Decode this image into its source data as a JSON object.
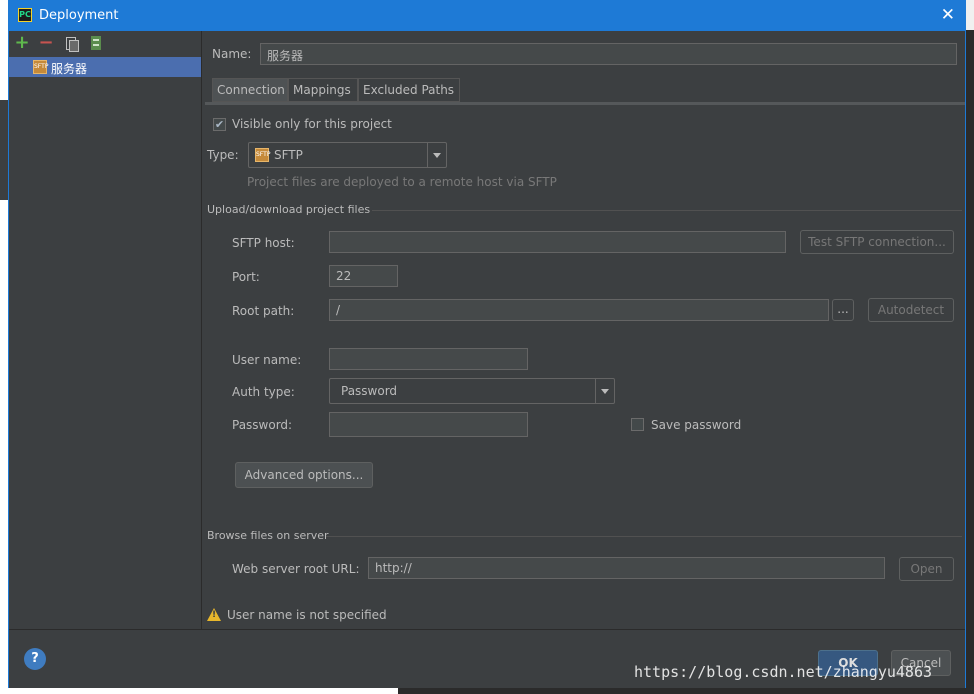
{
  "window": {
    "title": "Deployment",
    "app_icon": "PC"
  },
  "sidebar": {
    "toolbar": {
      "add": "+",
      "remove": "−"
    },
    "items": [
      {
        "label": "服务器",
        "icon": "sftp-icon"
      }
    ]
  },
  "form": {
    "name_label": "Name:",
    "name_value": "服务器",
    "tabs": [
      "Connection",
      "Mappings",
      "Excluded Paths"
    ],
    "visible_only_label": "Visible only for this project",
    "visible_only_checked": true,
    "type_label": "Type:",
    "type_value": "SFTP",
    "type_hint": "Project files are deployed to a remote host via SFTP",
    "upload_section": "Upload/download project files",
    "sftp_host_label": "SFTP host:",
    "sftp_host_value": "",
    "test_button": "Test SFTP connection...",
    "port_label": "Port:",
    "port_value": "22",
    "root_path_label": "Root path:",
    "root_path_value": "/",
    "browse_button": "...",
    "autodetect_button": "Autodetect",
    "user_name_label": "User name:",
    "user_name_value": "",
    "auth_type_label": "Auth type:",
    "auth_type_value": "Password",
    "password_label": "Password:",
    "password_value": "",
    "save_password_label": "Save password",
    "save_password_checked": false,
    "advanced_button": "Advanced options...",
    "browse_section": "Browse files on server",
    "web_root_label": "Web server root URL:",
    "web_root_value": "http://",
    "open_button": "Open",
    "warning_text": "User name is not specified"
  },
  "footer": {
    "help": "?",
    "ok": "OK",
    "cancel": "Cancel"
  },
  "watermark": "https://blog.csdn.net/zhangyu4863",
  "colors": {
    "titlebar": "#1e7ad6",
    "panel": "#3c3f41",
    "selection": "#4b6eaf",
    "warning": "#e8b72c"
  }
}
